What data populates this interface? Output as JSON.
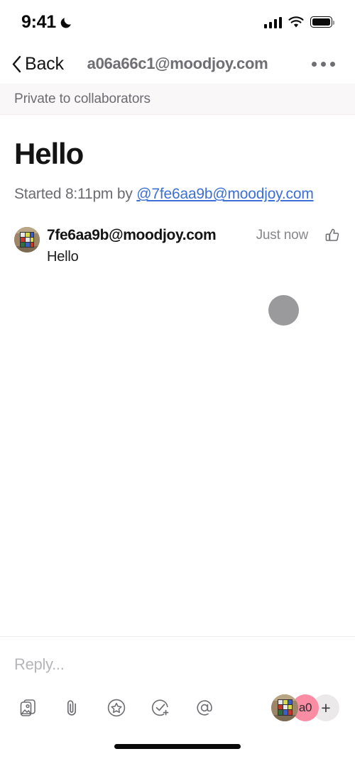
{
  "status_bar": {
    "time": "9:41",
    "moon_icon": "crescent-moon-icon",
    "cellular_icon": "cellular-signal-icon",
    "wifi_icon": "wifi-icon",
    "battery_icon": "battery-full-icon"
  },
  "nav": {
    "back_label": "Back",
    "back_icon": "chevron-left-icon",
    "title": "a06a66c1@moodjoy.com",
    "overflow_icon": "more-horizontal-icon"
  },
  "banner": {
    "text": "Private to collaborators"
  },
  "thread": {
    "title": "Hello",
    "started_prefix": "Started 8:11pm by ",
    "started_author": "@7fe6aa9b@moodjoy.com",
    "message": {
      "avatar_name": "user-avatar",
      "author": "7fe6aa9b@moodjoy.com",
      "timestamp": "Just now",
      "like_icon": "thumbs-up-icon",
      "body": "Hello"
    }
  },
  "composer": {
    "placeholder": "Reply...",
    "tools": [
      {
        "name": "photos-icon",
        "label": "Photos"
      },
      {
        "name": "paperclip-icon",
        "label": "Attach file"
      },
      {
        "name": "star-circle-icon",
        "label": "Star"
      },
      {
        "name": "check-circle-plus-icon",
        "label": "Add task"
      },
      {
        "name": "at-mention-circle-icon",
        "label": "Mention"
      }
    ],
    "participants": [
      {
        "name": "participant-avatar-photo",
        "label": ""
      },
      {
        "name": "participant-avatar-initials",
        "label": "a0"
      },
      {
        "name": "add-participant-button",
        "label": "+"
      }
    ]
  },
  "colors": {
    "mention_link": "#3d6fd4",
    "banner_bg": "#faf7f9",
    "pink_avatar": "#fa8ca4",
    "floating_dot": "#9a9a9d",
    "muted_text": "#6b6b70"
  },
  "home_indicator": "home-indicator"
}
